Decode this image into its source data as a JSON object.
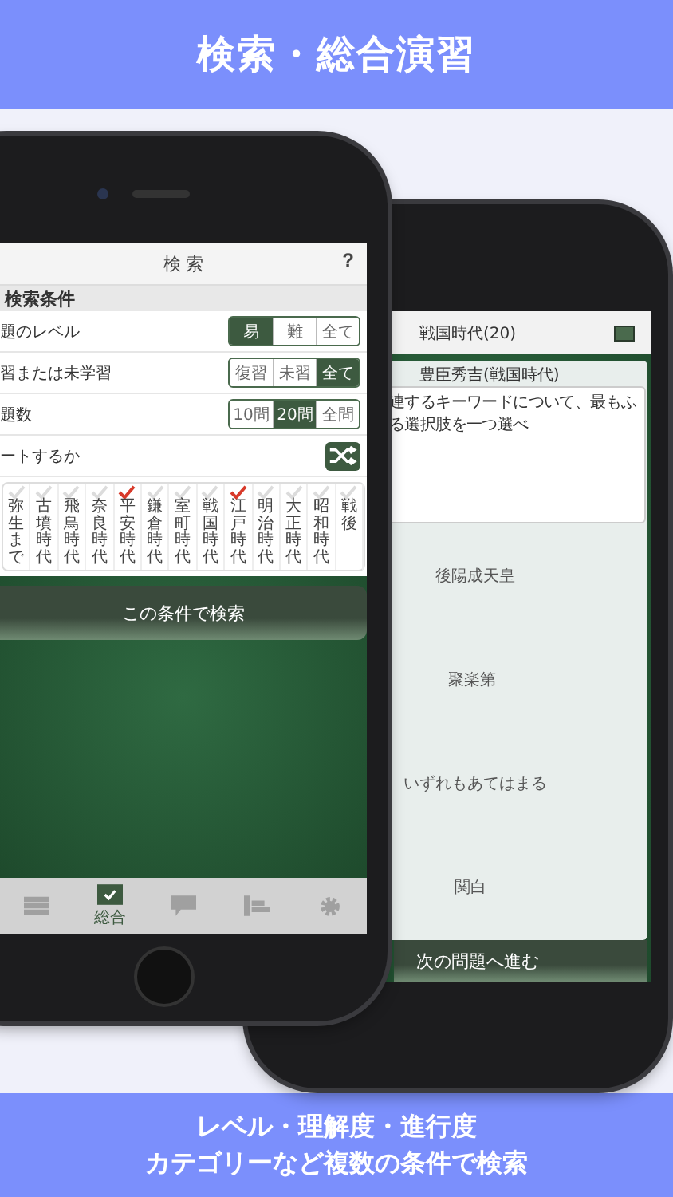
{
  "top_banner": {
    "title": "検索・総合演習"
  },
  "search_phone": {
    "title": "検 索",
    "help": "?",
    "section": "検索条件",
    "settings": [
      {
        "label": "題のレベル",
        "options": [
          {
            "label": "易",
            "selected": true
          },
          {
            "label": "難",
            "selected": false
          },
          {
            "label": "全て",
            "selected": false
          }
        ]
      },
      {
        "label": "習または未学習",
        "options": [
          {
            "label": "復習",
            "selected": false
          },
          {
            "label": "未習",
            "selected": false
          },
          {
            "label": "全て",
            "selected": true
          }
        ]
      },
      {
        "label": "題数",
        "options": [
          {
            "label": "10問",
            "selected": false
          },
          {
            "label": "20問",
            "selected": true
          },
          {
            "label": "全問",
            "selected": false
          }
        ]
      }
    ],
    "shuffle": {
      "label": "ートするか",
      "on": true
    },
    "eras": [
      {
        "label": "弥生まで",
        "checked": false
      },
      {
        "label": "古墳時代",
        "checked": false
      },
      {
        "label": "飛鳥時代",
        "checked": false
      },
      {
        "label": "奈良時代",
        "checked": false
      },
      {
        "label": "平安時代",
        "checked": true
      },
      {
        "label": "鎌倉時代",
        "checked": false
      },
      {
        "label": "室町時代",
        "checked": false
      },
      {
        "label": "戦国時代",
        "checked": false
      },
      {
        "label": "江戸時代",
        "checked": true
      },
      {
        "label": "明治時代",
        "checked": false
      },
      {
        "label": "大正時代",
        "checked": false
      },
      {
        "label": "昭和時代",
        "checked": false
      },
      {
        "label": "戦後",
        "checked": false
      }
    ],
    "search_button": "この条件で検索",
    "tabs": [
      {
        "kind": "list",
        "selected": false
      },
      {
        "kind": "check",
        "label": "総合",
        "selected": true
      },
      {
        "kind": "chat",
        "selected": false
      },
      {
        "kind": "chart",
        "selected": false
      },
      {
        "kind": "gear",
        "selected": false
      }
    ]
  },
  "quiz_phone": {
    "title": "戦国時代(20)",
    "subtitle": "豊臣秀吉(戦国時代)",
    "question_lines": [
      "連するキーワードについて、最もふ",
      "る選択肢を一つ選べ"
    ],
    "choices": [
      "後陽成天皇",
      "聚楽第",
      "いずれもあてはまる",
      "関白"
    ],
    "next_button": "次の問題へ進む"
  },
  "bottom_banner": {
    "lines": [
      "レベル・理解度・進行度",
      "カテゴリーなど複数の条件で検索"
    ]
  }
}
